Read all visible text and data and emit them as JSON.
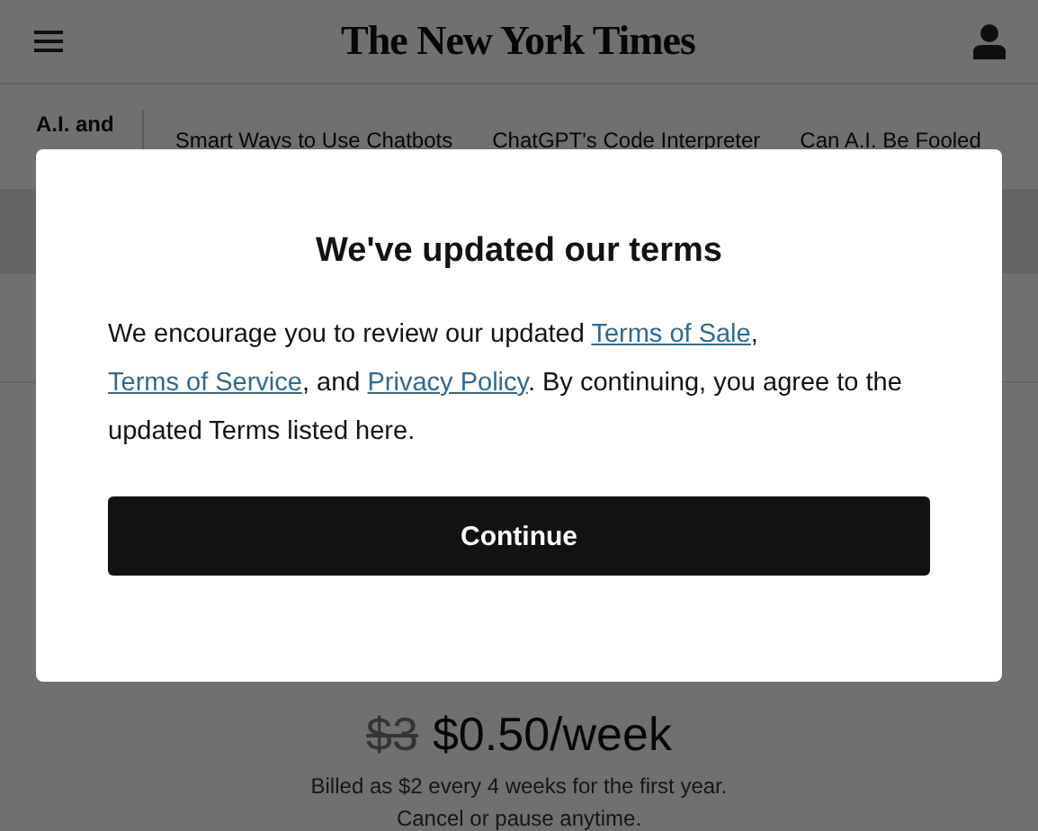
{
  "header": {
    "logo": "The New York Times"
  },
  "nav": {
    "section": "A.I. and",
    "links": [
      "Smart Ways to Use Chatbots",
      "ChatGPT's Code Interpreter",
      "Can A.I. Be Fooled"
    ]
  },
  "offer": {
    "old_price": "$3",
    "price": "$0.50/week",
    "billing": "Billed as $2 every 4 weeks for the first year.",
    "note": "Cancel or pause anytime."
  },
  "dialog": {
    "title": "We've updated our terms",
    "body": [
      {
        "kind": "text",
        "text": "We encourage you to review our updated "
      },
      {
        "kind": "link",
        "text": "Terms of Sale"
      },
      {
        "kind": "text",
        "text": ", "
      },
      {
        "kind": "link",
        "text": "Terms of Service"
      },
      {
        "kind": "text",
        "text": ", and "
      },
      {
        "kind": "link",
        "text": "Privacy Policy"
      },
      {
        "kind": "text",
        "text": ". By continuing, you agree to the updated Terms listed here."
      }
    ],
    "button": "Continue"
  }
}
